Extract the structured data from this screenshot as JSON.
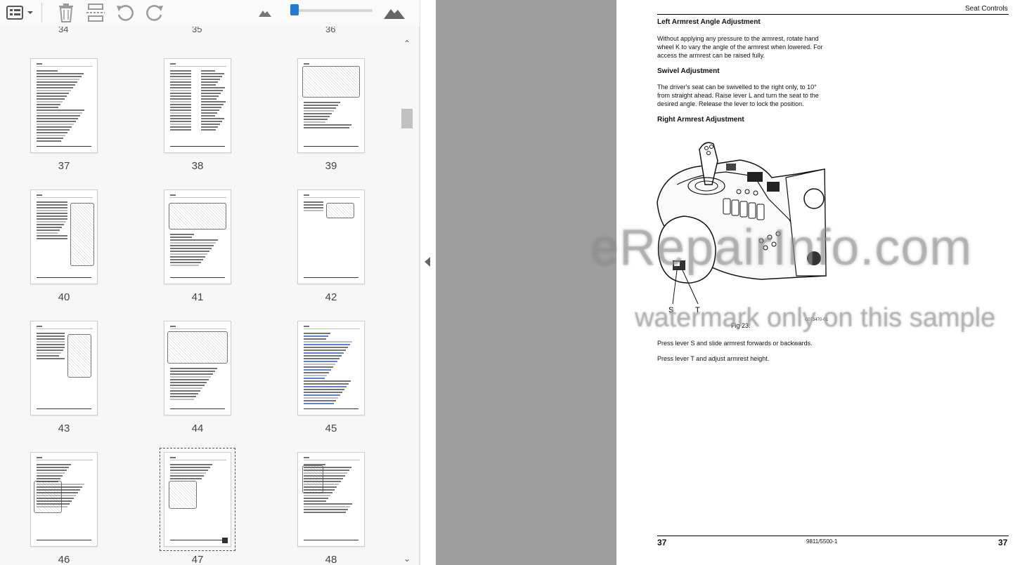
{
  "toolbar": {
    "view_menu_icon": "list-view-icon",
    "delete_icon": "trash-icon",
    "extract_icon": "extract-pages-icon",
    "undo_icon": "undo-icon",
    "redo_icon": "redo-icon",
    "zoom_out_icon": "mountain-small-icon",
    "zoom_in_icon": "mountain-large-icon",
    "zoom_level_fraction": 0.03,
    "accent": "#1f7ad1"
  },
  "thumbnails": {
    "cut_labels": [
      "34",
      "35",
      "36"
    ],
    "pages": [
      {
        "num": "37"
      },
      {
        "num": "38"
      },
      {
        "num": "39"
      },
      {
        "num": "40"
      },
      {
        "num": "41"
      },
      {
        "num": "42"
      },
      {
        "num": "43"
      },
      {
        "num": "44"
      },
      {
        "num": "45"
      },
      {
        "num": "46"
      },
      {
        "num": "47",
        "selected": true
      },
      {
        "num": "48"
      }
    ]
  },
  "document": {
    "header": "Seat Controls",
    "sections": {
      "left_armrest_title": "Left Armrest Angle Adjustment",
      "left_armrest_text": "Without applying any pressure to the armrest, rotate hand wheel K to vary the angle of the armrest when lowered. For access the armrest can be raised fully.",
      "swivel_title": "Swivel Adjustment",
      "swivel_text": "The driver's seat can be swivelled to the right only, to 10° from straight ahead. Raise lever L and turn the seat to the desired angle. Release the lever to lock the position.",
      "right_armrest_title": "Right Armrest Adjustment",
      "figure_label_s": "S",
      "figure_label_t": "T",
      "figure_code": "C073470-01",
      "figure_caption": "Fig 23.",
      "press_s_text": "Press lever S and slide armrest forwards or backwards.",
      "press_t_text": "Press lever T and adjust armrest height."
    },
    "footer": {
      "left_page": "37",
      "doc_number": "9811/5500-1",
      "right_page": "37"
    }
  },
  "watermark": {
    "site": "eRepairInfo.com",
    "note": "watermark only on this sample"
  }
}
